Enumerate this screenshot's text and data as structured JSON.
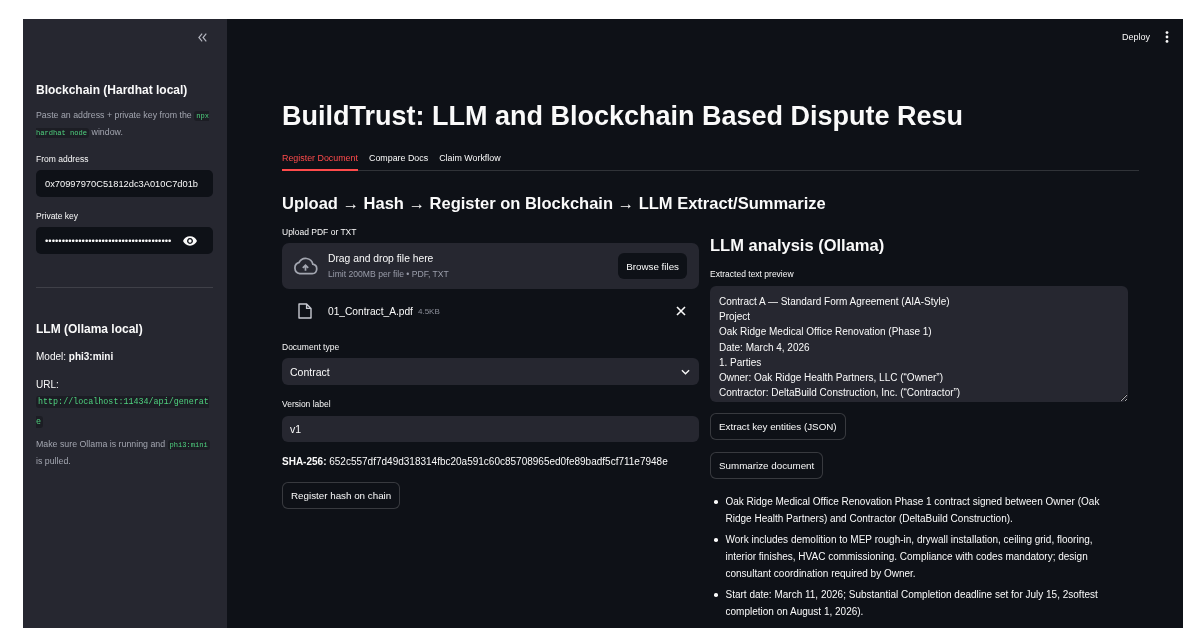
{
  "sidebar": {
    "blockchain": {
      "heading": "Blockchain (Hardhat local)",
      "caption": [
        {
          "kind": "text",
          "text": "Paste an address + private key from the "
        },
        {
          "kind": "code",
          "text": "npx hardhat node"
        },
        {
          "kind": "text",
          "text": " window."
        }
      ],
      "from_address": {
        "label": "From address",
        "value": "0x70997970C51812dc3A010C7d01b"
      },
      "private_key": {
        "label": "Private key",
        "value": "••••••••••••••••••••••••••••••••••••••"
      }
    },
    "llm": {
      "heading": "LLM (Ollama local)",
      "model": "Model: **phi3:mini**",
      "url_label": "URL:",
      "url": "http://localhost:11434/api/generate",
      "note": [
        {
          "kind": "text",
          "text": "Make sure Ollama is running and "
        },
        {
          "kind": "code",
          "text": "phi3:mini"
        },
        {
          "kind": "text",
          "text": " is pulled."
        }
      ]
    }
  },
  "header": {
    "deploy": "Deploy"
  },
  "title": "BuildTrust: LLM and Blockchain Based Dispute Resu",
  "tabs": [
    {
      "label": "Register Document",
      "selected": true
    },
    {
      "label": "Compare Docs",
      "selected": false
    },
    {
      "label": "Claim Workflow",
      "selected": false
    }
  ],
  "section_heading": "Upload → Hash → Register on Blockchain → LLM Extract/Summarize",
  "upload": {
    "label": "Upload PDF or TXT",
    "dropzone_title": "Drag and drop file here",
    "dropzone_limits": "Limit 200MB per file • PDF, TXT",
    "browse_button": "Browse files",
    "file": {
      "name": "01_Contract_A.pdf",
      "size": "4.5KB"
    }
  },
  "document_type": {
    "label": "Document type",
    "value": "Contract"
  },
  "version_label": {
    "label": "Version label",
    "value": "v1"
  },
  "hash": "**SHA-256:** 652c557df7d49d318314fbc20a591c60c85708965ed0fe89badf5cf711e7948e",
  "register_button": "Register hash on chain",
  "llm_analysis": {
    "heading": "LLM analysis (Ollama)",
    "preview_label": "Extracted text preview",
    "preview_lines": [
      "Contract A — Standard Form Agreement (AIA-Style)",
      "Project",
      "Oak Ridge Medical Office Renovation (Phase 1)",
      "Date: March 4, 2026",
      "1. Parties",
      "Owner: Oak Ridge Health Partners, LLC (“Owner”)",
      "Contractor: DeltaBuild Construction, Inc. (“Contractor”)"
    ],
    "extract_button": "Extract key entities (JSON)",
    "summarize_button": "Summarize document",
    "summary": [
      "Oak Ridge Medical Office Renovation Phase 1 contract signed between Owner (Oak Ridge Health Partners) and Contractor (DeltaBuild Construction).",
      "Work includes demolition to MEP rough-in, drywall installation, ceiling grid, flooring, interior finishes, HVAC commissioning. Compliance with codes mandatory; design consultant coordination required by Owner.",
      "Start date: March 11, 2026; Substantial Completion deadline set for July 15, 2softest completion on August 1, 2026)."
    ]
  }
}
